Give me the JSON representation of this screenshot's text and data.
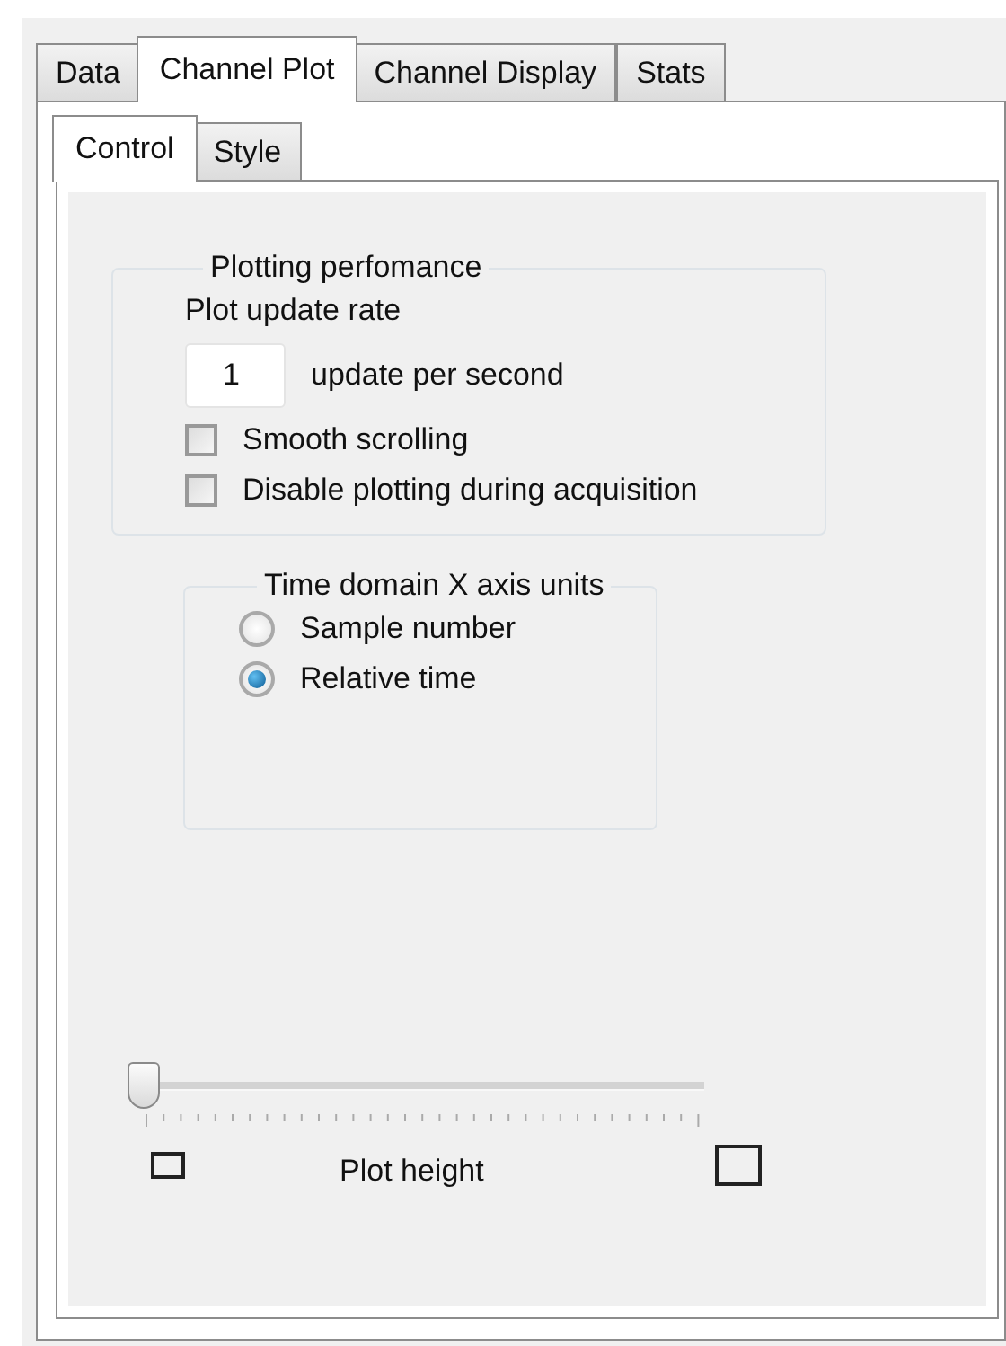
{
  "tabs": [
    {
      "label": "Data",
      "selected": false
    },
    {
      "label": "Channel Plot",
      "selected": true
    },
    {
      "label": "Channel Display",
      "selected": false
    },
    {
      "label": "Stats",
      "selected": false
    }
  ],
  "subtabs": [
    {
      "label": "Control",
      "selected": true
    },
    {
      "label": "Style",
      "selected": false
    }
  ],
  "plotting_performance": {
    "title": "Plotting perfomance",
    "rate_label": "Plot update rate",
    "rate_value": "1",
    "rate_unit": "update per second",
    "options": [
      {
        "label": "Smooth scrolling",
        "checked": false
      },
      {
        "label": "Disable plotting during acquisition",
        "checked": false
      }
    ]
  },
  "x_axis_units": {
    "title": "Time domain X axis units",
    "options": [
      {
        "label": "Sample number",
        "selected": false
      },
      {
        "label": "Relative time",
        "selected": true
      }
    ]
  },
  "plot_height": {
    "label": "Plot height",
    "level": 0.0
  }
}
